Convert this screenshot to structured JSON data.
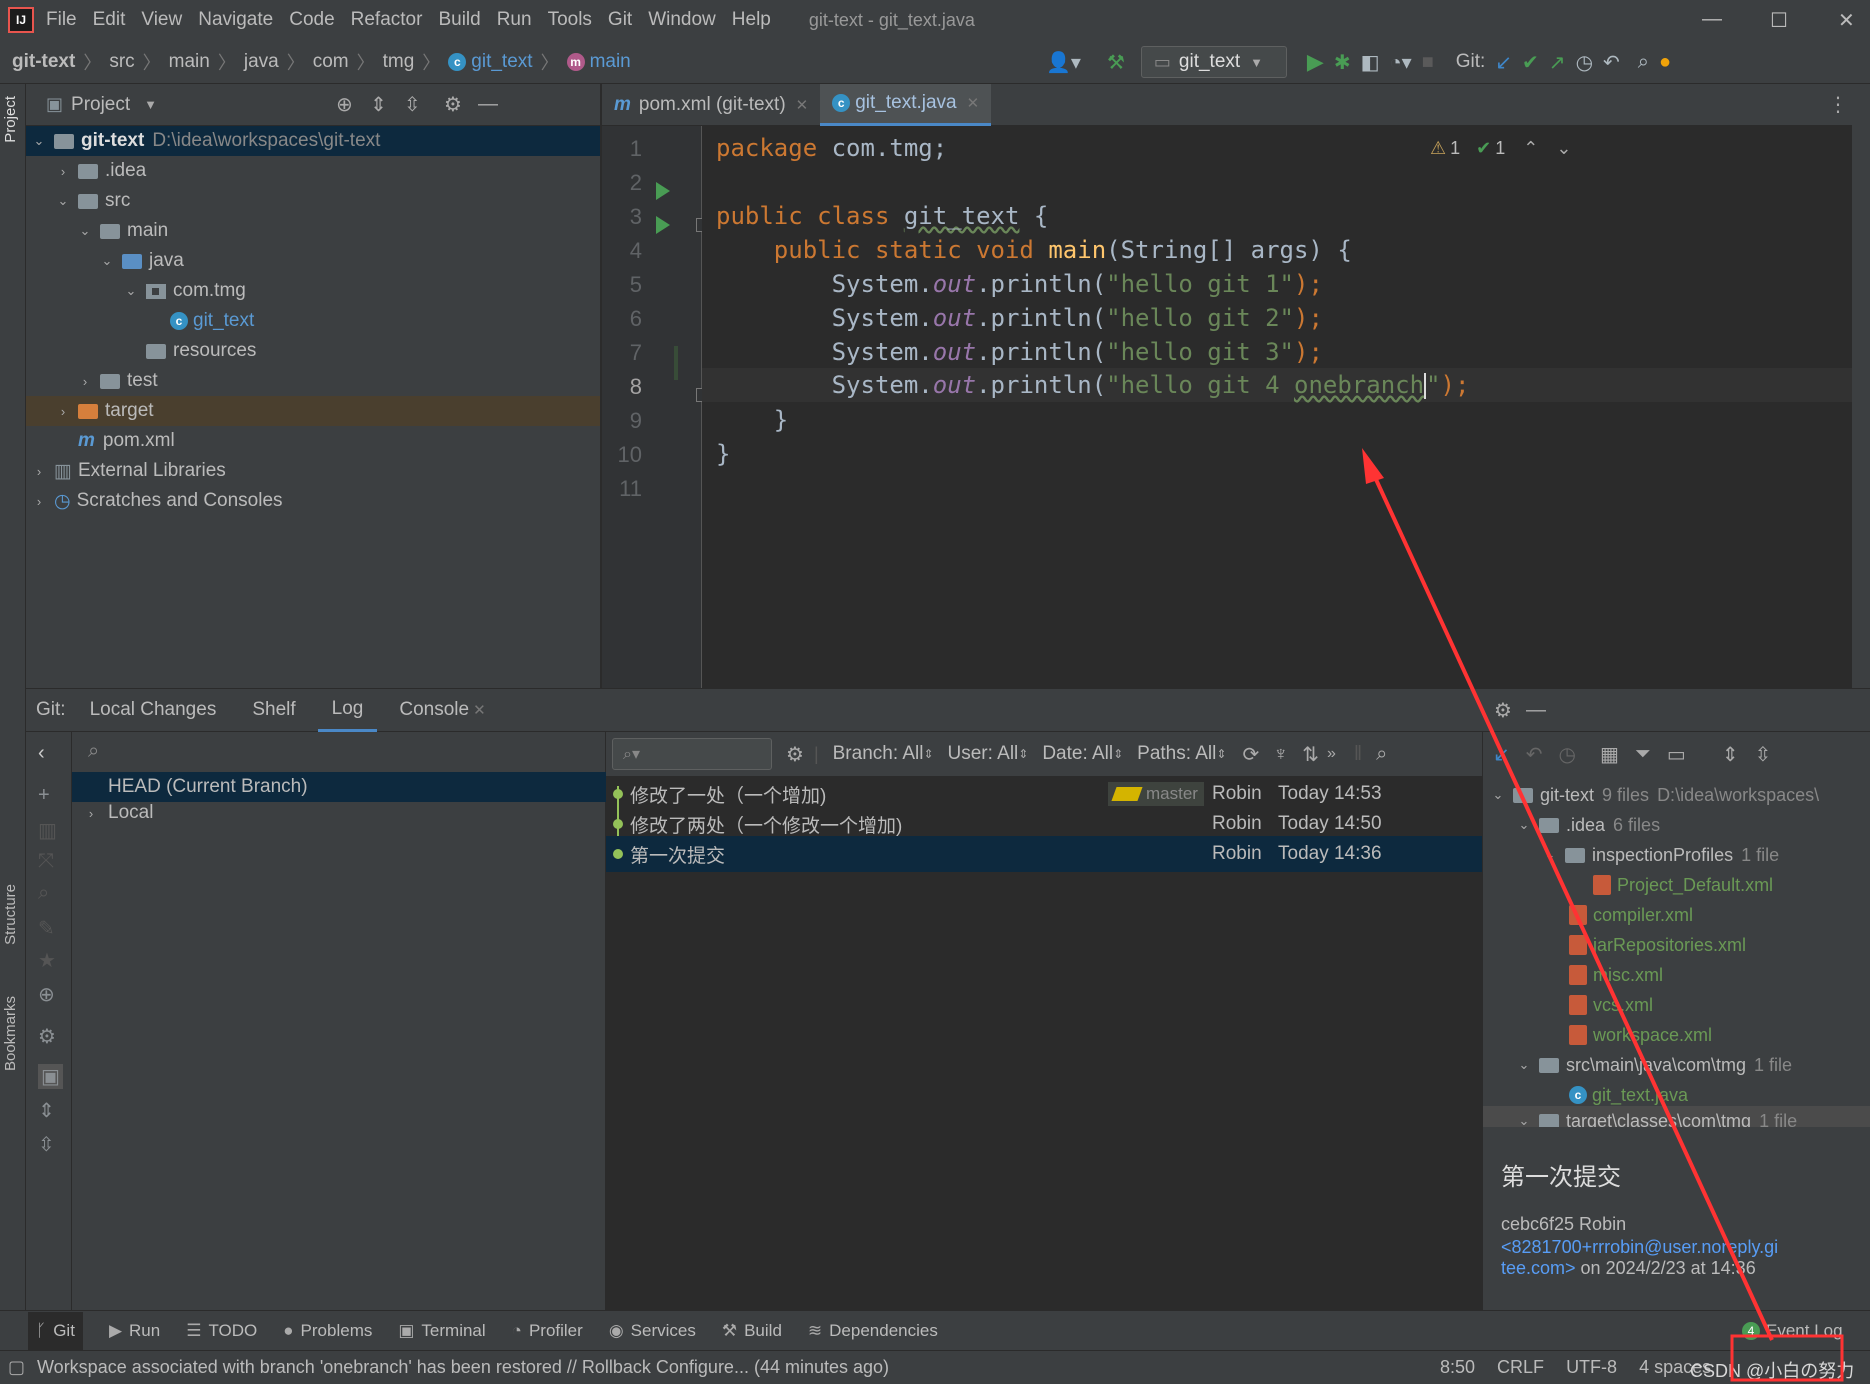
{
  "menubar": {
    "items": [
      "File",
      "Edit",
      "View",
      "Navigate",
      "Code",
      "Refactor",
      "Build",
      "Run",
      "Tools",
      "Git",
      "Window",
      "Help"
    ],
    "title": "git-text - git_text.java"
  },
  "breadcrumb": [
    "git-text",
    "src",
    "main",
    "java",
    "com",
    "tmg",
    "git_text",
    "main"
  ],
  "toolbar": {
    "run_config": "git_text",
    "git_label": "Git:"
  },
  "left_strip": {
    "project": "Project",
    "structure": "Structure",
    "bookmarks": "Bookmarks"
  },
  "project_panel": {
    "title": "Project",
    "root": {
      "name": "git-text",
      "path": "D:\\idea\\workspaces\\git-text"
    },
    "items": [
      ".idea",
      "src",
      "main",
      "java",
      "com.tmg",
      "git_text",
      "resources",
      "test",
      "target",
      "pom.xml",
      "External Libraries",
      "Scratches and Consoles"
    ]
  },
  "editor": {
    "tabs": [
      {
        "label": "pom.xml (git-text)",
        "icon": "maven-icon"
      },
      {
        "label": "git_text.java",
        "icon": "class-icon",
        "active": true
      }
    ],
    "line_numbers": [
      "1",
      "2",
      "3",
      "4",
      "5",
      "6",
      "7",
      "8",
      "9",
      "10",
      "11"
    ],
    "current_line": 8,
    "inspections": {
      "warnings": "1",
      "ok": "1"
    },
    "code": {
      "l1_kw": "package",
      "l1_rest": " com.tmg;",
      "l3_kw": "public class",
      "l3_name": "git_text",
      "l3_rest": " {",
      "l4_kw": "public static void",
      "l4_fn": "main",
      "l4_rest": "(String[] args) {",
      "print_prefix": "System.",
      "print_out": "out",
      "print_call": ".println(",
      "l5_str": "\"hello git 1\"",
      "l6_str": "\"hello git 2\"",
      "l7_str": "\"hello git 3\"",
      "l8_str_a": "\"hello git 4 ",
      "l8_str_b": "onebranch",
      "l8_str_c": "\"",
      "print_end": ");",
      "l9": "}",
      "l10": "}"
    }
  },
  "git_window": {
    "prefix": "Git:",
    "tabs": [
      "Local Changes",
      "Shelf",
      "Log",
      "Console"
    ],
    "active_tab": "Log",
    "branches": [
      "HEAD (Current Branch)",
      "Local"
    ],
    "filters": [
      "Branch: All",
      "User: All",
      "Date: All",
      "Paths: All"
    ],
    "commits": [
      {
        "message": "修改了一处（一个增加)",
        "tag": "master",
        "author": "Robin",
        "date": "Today 14:53"
      },
      {
        "message": "修改了两处（一个修改一个增加)",
        "author": "Robin",
        "date": "Today 14:50"
      },
      {
        "message": "第一次提交",
        "author": "Robin",
        "date": "Today 14:36"
      }
    ],
    "changes": {
      "root": {
        "name": "git-text",
        "count": "9 files",
        "path": "D:\\idea\\workspaces\\"
      },
      "idea": {
        "name": ".idea",
        "count": "6 files"
      },
      "inspection": {
        "name": "inspectionProfiles",
        "count": "1 file"
      },
      "idea_files": [
        "Project_Default.xml",
        "compiler.xml",
        "jarRepositories.xml",
        "misc.xml",
        "vcs.xml",
        "workspace.xml"
      ],
      "src_dir": {
        "name": "src\\main\\java\\com\\tmg",
        "count": "1 file"
      },
      "src_file": "git_text.java",
      "target_dir": {
        "name": "target\\classes\\com\\tmg",
        "count": "1 file"
      }
    },
    "details": {
      "title": "第一次提交",
      "hash_author": "cebc6f25 Robin",
      "email_a": "<8281700+rrrobin@user.noreply.gi",
      "email_b": "tee.com>",
      "date_suffix": " on 2024/2/23 at 14:36"
    }
  },
  "tool_strip": [
    "Git",
    "Run",
    "TODO",
    "Problems",
    "Terminal",
    "Profiler",
    "Services",
    "Build",
    "Dependencies"
  ],
  "event_log": {
    "label": "Event Log",
    "count": "4"
  },
  "status": {
    "message": "Workspace associated with branch 'onebranch' has been restored // Rollback   Configure... (44 minutes ago)",
    "position": "8:50",
    "line_sep": "CRLF",
    "encoding": "UTF-8",
    "indent": "4 spaces",
    "watermark": "CSDN @小白の努力"
  },
  "colors": {
    "accent": "#4a88c7",
    "selection": "#0d293e",
    "annotation": "#ff3333",
    "keyword": "#cc7832",
    "string": "#6a8759"
  }
}
